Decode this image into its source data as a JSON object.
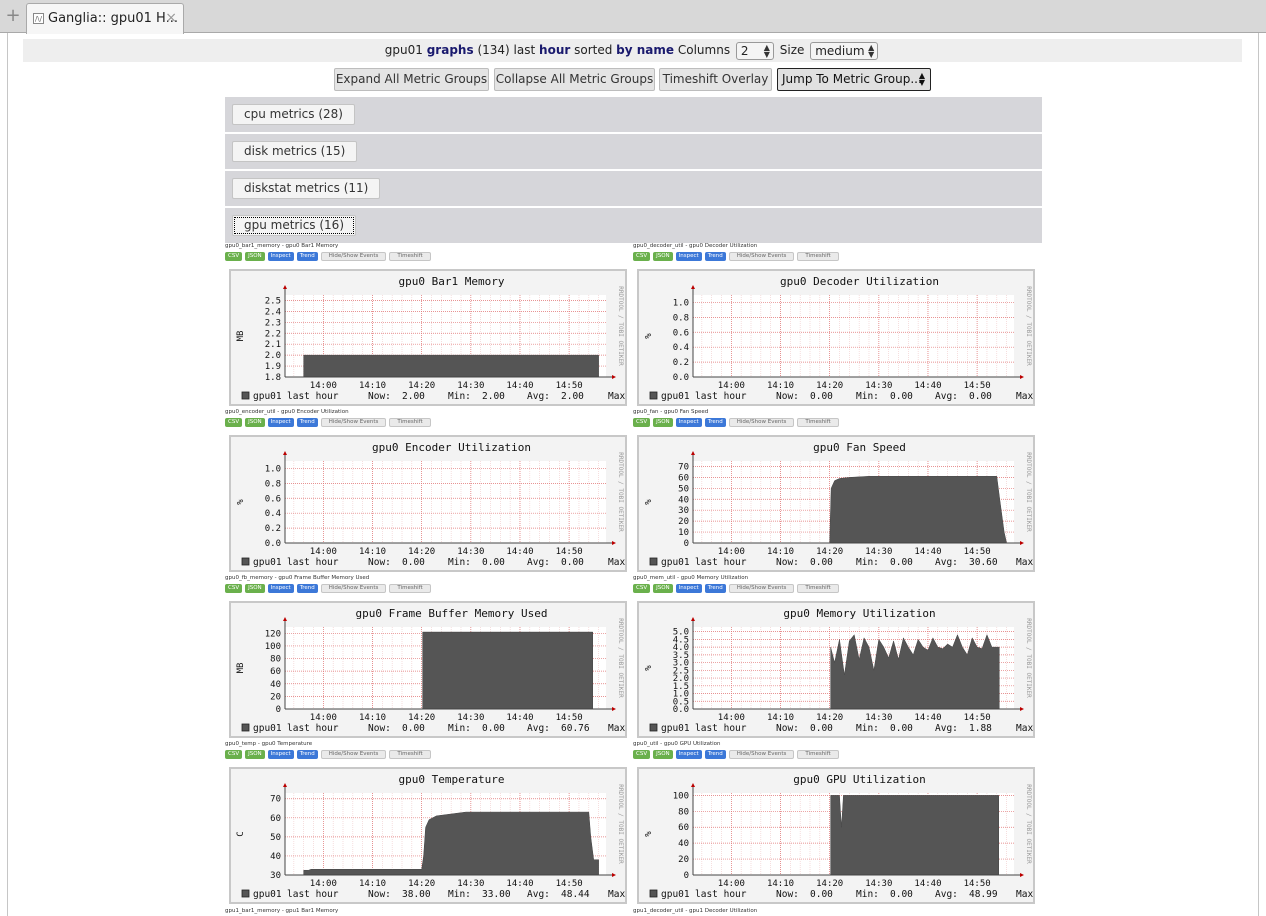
{
  "browser": {
    "tab_title": "Ganglia:: gpu01 H...",
    "new_tab": "+",
    "close": "×"
  },
  "header": {
    "host": "gpu01",
    "graphs_word": "graphs",
    "count": "(134)",
    "last_word": "last",
    "range": "hour",
    "sorted_word": "sorted",
    "by_name": "by name",
    "columns_label": "Columns",
    "columns_value": "2",
    "size_label": "Size",
    "size_value": "medium"
  },
  "buttons": {
    "expand": "Expand All Metric Groups",
    "collapse": "Collapse All Metric Groups",
    "timeshift": "Timeshift Overlay",
    "jump": "Jump To Metric Group..."
  },
  "groups": [
    {
      "label": "cpu metrics (28)"
    },
    {
      "label": "disk metrics (15)"
    },
    {
      "label": "diskstat metrics (11)"
    },
    {
      "label": "gpu metrics (16)"
    }
  ],
  "chips": {
    "csv": "CSV",
    "json": "JSON",
    "inspect": "Inspect",
    "trend": "Trend",
    "events": "Hide/Show Events",
    "timeshift": "Timeshift"
  },
  "rrdtool_watermark": "RRDTOOL / TOBI OETIKER",
  "x_ticks": [
    "14:00",
    "14:10",
    "14:20",
    "14:30",
    "14:40",
    "14:50"
  ],
  "legend": {
    "host": "gpu01",
    "period": "last hour",
    "now": "Now:",
    "min": "Min:",
    "avg": "Avg:",
    "max": "Max:"
  },
  "next_labels": [
    "gpu1_bar1_memory - gpu1 Bar1 Memory",
    "gpu1_decoder_util - gpu1 Decoder Utilization"
  ],
  "chart_data": [
    {
      "type": "area",
      "metric_label": "gpu0_bar1_memory - gpu0 Bar1 Memory",
      "title": "gpu0 Bar1 Memory",
      "ylabel": "MB",
      "yticks": [
        "1.8",
        "1.9",
        "2.0",
        "2.1",
        "2.2",
        "2.3",
        "2.4",
        "2.5"
      ],
      "ylim": [
        1.8,
        2.55
      ],
      "series": [
        {
          "name": "gpu01 last hour",
          "points": [
            [
              0,
              2.0
            ],
            [
              60,
              2.0
            ]
          ]
        }
      ],
      "now": "2.00",
      "min": "2.00",
      "avg": "2.00"
    },
    {
      "type": "area",
      "metric_label": "gpu0_decoder_util - gpu0 Decoder Utilization",
      "title": "gpu0 Decoder Utilization",
      "ylabel": "%",
      "yticks": [
        "0.0",
        "0.2",
        "0.4",
        "0.6",
        "0.8",
        "1.0"
      ],
      "ylim": [
        0,
        1.1
      ],
      "series": [
        {
          "name": "gpu01 last hour",
          "points": [
            [
              0,
              0
            ],
            [
              60,
              0
            ]
          ]
        }
      ],
      "now": "0.00",
      "min": "0.00",
      "avg": "0.00"
    },
    {
      "type": "area",
      "metric_label": "gpu0_encoder_util - gpu0 Encoder Utilization",
      "title": "gpu0 Encoder Utilization",
      "ylabel": "%",
      "yticks": [
        "0.0",
        "0.2",
        "0.4",
        "0.6",
        "0.8",
        "1.0"
      ],
      "ylim": [
        0,
        1.1
      ],
      "series": [
        {
          "name": "gpu01 last hour",
          "points": [
            [
              0,
              0
            ],
            [
              60,
              0
            ]
          ]
        }
      ],
      "now": "0.00",
      "min": "0.00",
      "avg": "0.00"
    },
    {
      "type": "area",
      "metric_label": "gpu0_fan - gpu0 Fan Speed",
      "title": "gpu0 Fan Speed",
      "ylabel": "%",
      "yticks": [
        "0",
        "10",
        "20",
        "30",
        "40",
        "50",
        "60",
        "70"
      ],
      "ylim": [
        0,
        75
      ],
      "series": [
        {
          "name": "gpu01 last hour",
          "points": [
            [
              24,
              0
            ],
            [
              24.3,
              50
            ],
            [
              25,
              57
            ],
            [
              26,
              59
            ],
            [
              28,
              60
            ],
            [
              32,
              61
            ],
            [
              58,
              61
            ],
            [
              58.6,
              40
            ],
            [
              59.5,
              10
            ],
            [
              60,
              0
            ]
          ]
        }
      ],
      "now": "0.00",
      "min": "0.00",
      "avg": "30.60"
    },
    {
      "type": "area",
      "metric_label": "gpu0_fb_memory - gpu0 Frame Buffer Memory Used",
      "title": "gpu0 Frame Buffer Memory Used",
      "ylabel": "MB",
      "yticks": [
        "0",
        "20",
        "40",
        "60",
        "80",
        "100",
        "120"
      ],
      "ylim": [
        0,
        130
      ],
      "series": [
        {
          "name": "gpu01 last hour",
          "points": [
            [
              24.2,
              0
            ],
            [
              24.2,
              122
            ],
            [
              58.8,
              122
            ],
            [
              58.8,
              0
            ]
          ]
        }
      ],
      "now": "0.00",
      "min": "0.00",
      "avg": "60.76"
    },
    {
      "type": "area",
      "metric_label": "gpu0_mem_util - gpu0 Memory Utilization",
      "title": "gpu0 Memory Utilization",
      "ylabel": "%",
      "yticks": [
        "0.0",
        "0.5",
        "1.0",
        "1.5",
        "2.0",
        "2.5",
        "3.0",
        "3.5",
        "4.0",
        "4.5",
        "5.0"
      ],
      "ylim": [
        0,
        5.3
      ],
      "series": [
        {
          "name": "gpu01 last hour",
          "points": [
            [
              24.2,
              0
            ],
            [
              24.2,
              4.0
            ],
            [
              25,
              3.0
            ],
            [
              26,
              4.5
            ],
            [
              27,
              2.2
            ],
            [
              28,
              4.4
            ],
            [
              29,
              4.8
            ],
            [
              30,
              3.2
            ],
            [
              31,
              4.6
            ],
            [
              32,
              4.0
            ],
            [
              33,
              2.5
            ],
            [
              34,
              4.5
            ],
            [
              35,
              4.0
            ],
            [
              36,
              3.3
            ],
            [
              37,
              4.4
            ],
            [
              38,
              3.2
            ],
            [
              39,
              4.6
            ],
            [
              40,
              4.0
            ],
            [
              41,
              3.5
            ],
            [
              42,
              4.5
            ],
            [
              43,
              4.0
            ],
            [
              44,
              3.8
            ],
            [
              45,
              4.6
            ],
            [
              46,
              4.0
            ],
            [
              47,
              3.9
            ],
            [
              48,
              4.2
            ],
            [
              49,
              4.0
            ],
            [
              50,
              4.8
            ],
            [
              51,
              4.0
            ],
            [
              52,
              3.5
            ],
            [
              53,
              4.6
            ],
            [
              54,
              4.0
            ],
            [
              55,
              3.9
            ],
            [
              56,
              4.8
            ],
            [
              57,
              4.0
            ],
            [
              58.5,
              4.0
            ],
            [
              58.5,
              0
            ]
          ]
        }
      ],
      "now": "0.00",
      "min": "0.00",
      "avg": "1.88"
    },
    {
      "type": "area",
      "metric_label": "gpu0_temp - gpu0 Temperature",
      "title": "gpu0 Temperature",
      "ylabel": "C",
      "yticks": [
        "30",
        "40",
        "50",
        "60",
        "70"
      ],
      "ylim": [
        30,
        73
      ],
      "series": [
        {
          "name": "gpu01 last hour",
          "points": [
            [
              0,
              32.5
            ],
            [
              1,
              32.5
            ],
            [
              1.5,
              33
            ],
            [
              10,
              33
            ],
            [
              18,
              33
            ],
            [
              24,
              33
            ],
            [
              24.4,
              40
            ],
            [
              24.8,
              55
            ],
            [
              25.5,
              59
            ],
            [
              27,
              61
            ],
            [
              30,
              62
            ],
            [
              33,
              63
            ],
            [
              40,
              63
            ],
            [
              50,
              63
            ],
            [
              58,
              63
            ],
            [
              58.4,
              50
            ],
            [
              59,
              38
            ],
            [
              60,
              38
            ]
          ]
        }
      ],
      "now": "38.00",
      "min": "33.00",
      "avg": "48.44"
    },
    {
      "type": "area",
      "metric_label": "gpu0_util - gpu0 GPU Utilization",
      "title": "gpu0 GPU Utilization",
      "ylabel": "%",
      "yticks": [
        "0",
        "20",
        "40",
        "60",
        "80",
        "100"
      ],
      "ylim": [
        0,
        103
      ],
      "series": [
        {
          "name": "gpu01 last hour",
          "points": [
            [
              24.2,
              0
            ],
            [
              24.2,
              100
            ],
            [
              26,
              100
            ],
            [
              26.4,
              60
            ],
            [
              26.8,
              100
            ],
            [
              58.4,
              100
            ],
            [
              58.4,
              0
            ]
          ]
        }
      ],
      "now": "0.00",
      "min": "0.00",
      "avg": "48.99"
    }
  ]
}
